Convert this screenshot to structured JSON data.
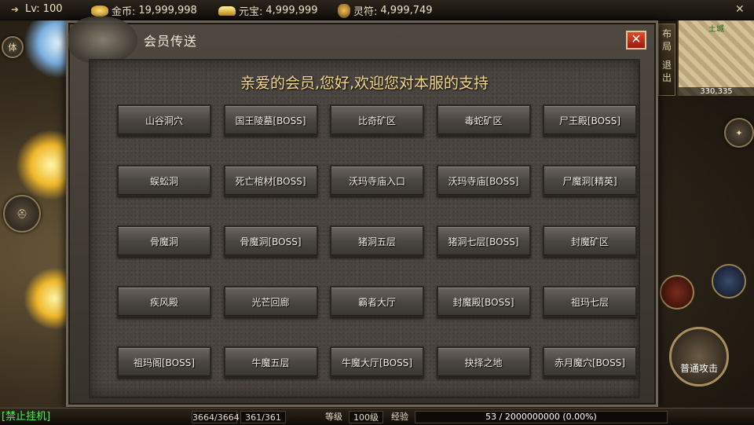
{
  "topbar": {
    "level": "Lv: 100",
    "gold_label": "金币:",
    "gold_value": "19,999,998",
    "yuanbao_label": "元宝:",
    "yuanbao_value": "4,999,999",
    "lingfu_label": "灵符:",
    "lingfu_value": "4,999,749"
  },
  "dialog": {
    "title": "会员传送",
    "close_label": "✕",
    "welcome": "亲爱的会员,您好,欢迎您对本服的支持",
    "destinations": [
      "山谷洞穴",
      "国王陵墓[BOSS]",
      "比奇矿区",
      "毒蛇矿区",
      "尸王殿[BOSS]",
      "蜈蚣洞",
      "死亡棺材[BOSS]",
      "沃玛寺庙入口",
      "沃玛寺庙[BOSS]",
      "尸魔洞[精英]",
      "骨魔洞",
      "骨魔洞[BOSS]",
      "猪洞五层",
      "猪洞七层[BOSS]",
      "封魔矿区",
      "疾风殿",
      "光芒回廊",
      "霸者大厅",
      "封魔殿[BOSS]",
      "祖玛七层",
      "祖玛阁[BOSS]",
      "牛魔五层",
      "牛魔大厅[BOSS]",
      "抉择之地",
      "赤月魔穴[BOSS]"
    ]
  },
  "minimap": {
    "town_label": "土城",
    "coords": "330,335"
  },
  "side_tabs": {
    "layout": "布局",
    "exit": "退出"
  },
  "attack_button": "普通攻击",
  "bottombar": {
    "autofight": "[禁止挂机]",
    "hp": "3664/3664",
    "mp": "361/361",
    "level_label": "等级",
    "level_value": "100级",
    "exp_label": "经验",
    "exp_text": "53 / 2000000000 (0.00%)",
    "exp_fraction": 0.0
  },
  "colors": {
    "welcome": "#f4d68a",
    "autofight": "#3cff3c",
    "close": "#e24a2a"
  }
}
